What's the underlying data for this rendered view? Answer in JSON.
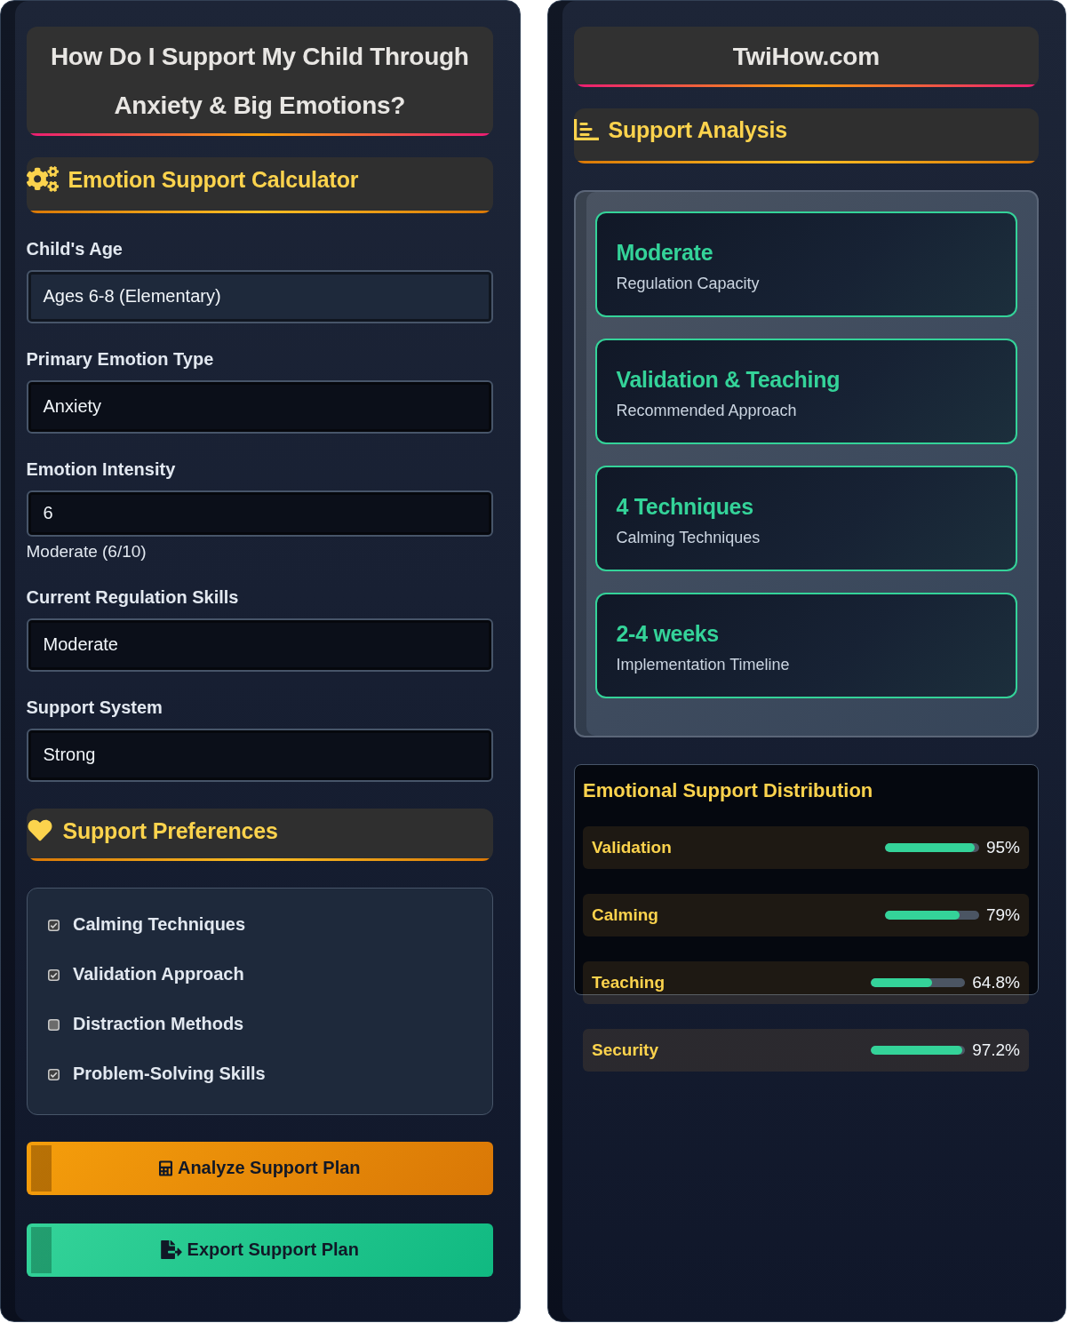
{
  "left_panel": {
    "title": "How Do I Support My Child Through Anxiety & Big Emotions?",
    "calculator_heading": "Emotion Support Calculator",
    "fields": [
      {
        "kind": "select",
        "label": "Child's Age",
        "value": "Ages 6-8 (Elementary)",
        "focused": true
      },
      {
        "kind": "select",
        "label": "Primary Emotion Type",
        "value": "Anxiety",
        "focused": false
      },
      {
        "kind": "number",
        "label": "Emotion Intensity",
        "value": "6",
        "hint": "Moderate (6/10)",
        "focused": false
      },
      {
        "kind": "select",
        "label": "Current Regulation Skills",
        "value": "Moderate",
        "focused": false
      },
      {
        "kind": "select",
        "label": "Support System",
        "value": "Strong",
        "focused": false
      }
    ],
    "preferences_heading": "Support Preferences",
    "preferences": [
      {
        "label": "Calming Techniques",
        "checked": true
      },
      {
        "label": "Validation Approach",
        "checked": true
      },
      {
        "label": "Distraction Methods",
        "checked": false
      },
      {
        "label": "Problem-Solving Skills",
        "checked": true
      }
    ],
    "buttons": [
      {
        "kind": "analyze",
        "label": "Analyze Support Plan"
      },
      {
        "kind": "export",
        "label": "Export Support Plan"
      }
    ]
  },
  "right_panel": {
    "site_title": "TwiHow.com",
    "analysis_heading": "Support Analysis",
    "results": [
      {
        "value": "Moderate",
        "label": "Regulation Capacity"
      },
      {
        "value": "Validation & Teaching",
        "label": "Recommended Approach"
      },
      {
        "value": "4 Techniques",
        "label": "Calming Techniques"
      },
      {
        "value": "2-4 weeks",
        "label": "Implementation Timeline"
      }
    ],
    "distribution": {
      "title": "Emotional Support Distribution",
      "rows": [
        {
          "label": "Validation",
          "level": 0.95,
          "reading": "95%"
        },
        {
          "label": "Calming",
          "level": 0.79,
          "reading": "79%"
        },
        {
          "label": "Teaching",
          "level": 0.648,
          "reading": "64.8%"
        },
        {
          "label": "Security",
          "level": 0.972,
          "reading": "97.2%"
        }
      ]
    }
  }
}
